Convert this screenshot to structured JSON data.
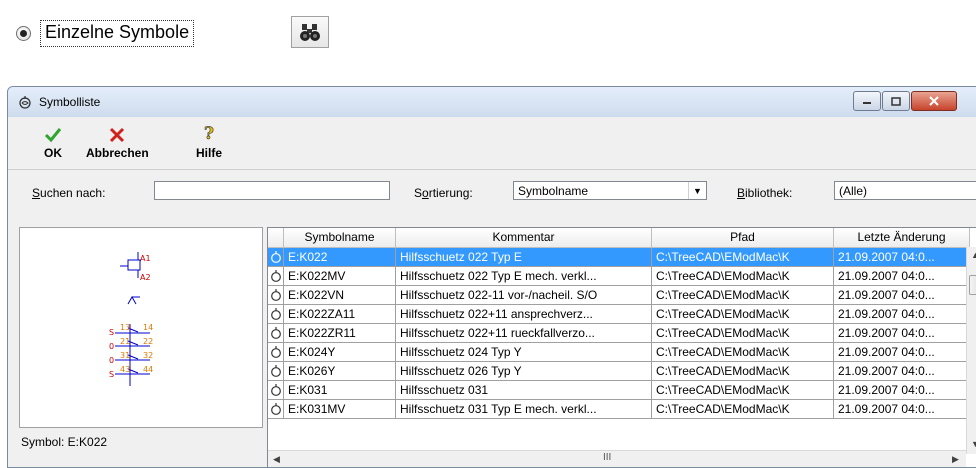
{
  "top": {
    "radio_label": "Einzelne Symbole",
    "radio_checked": true,
    "search_button_icon": "binoculars-icon"
  },
  "window": {
    "title": "Symbolliste",
    "title_icon": "coil-icon"
  },
  "toolbar": {
    "ok_label": "OK",
    "cancel_label": "Abbrechen",
    "help_label": "Hilfe"
  },
  "search": {
    "search_label_underlined": "S",
    "search_label_rest": "uchen nach:",
    "search_value": "",
    "sort_label_pre": "S",
    "sort_label_underlined": "o",
    "sort_label_rest": "rtierung:",
    "sort_value": "Symbolname",
    "library_label_underlined": "B",
    "library_label_rest": "ibliothek:",
    "library_value": "(Alle)"
  },
  "preview": {
    "caption": "Symbol: E:K022",
    "labels": {
      "a1": "A1",
      "a2": "A2",
      "n13": "13",
      "n14": "14",
      "n21": "21",
      "n22": "22",
      "n31": "31",
      "n32": "32",
      "n43": "43",
      "n44": "44",
      "s1": "S",
      "s2": "0",
      "s3": "0",
      "s4": "S"
    }
  },
  "table": {
    "columns": [
      "",
      "Symbolname",
      "Kommentar",
      "Pfad",
      "Letzte Änderung"
    ],
    "rows": [
      {
        "name": "E:K022",
        "comment": "Hilfsschuetz 022 Typ E",
        "path": "C:\\TreeCAD\\EModMac\\K",
        "date": "21.09.2007 04:0...",
        "selected": true
      },
      {
        "name": "E:K022MV",
        "comment": "Hilfsschuetz 022 Typ E mech. verkl...",
        "path": "C:\\TreeCAD\\EModMac\\K",
        "date": "21.09.2007 04:0..."
      },
      {
        "name": "E:K022VN",
        "comment": "Hilfsschuetz 022-11 vor-/nacheil. S/O",
        "path": "C:\\TreeCAD\\EModMac\\K",
        "date": "21.09.2007 04:0..."
      },
      {
        "name": "E:K022ZA11",
        "comment": "Hilfsschuetz 022+11 ansprechverz...",
        "path": "C:\\TreeCAD\\EModMac\\K",
        "date": "21.09.2007 04:0..."
      },
      {
        "name": "E:K022ZR11",
        "comment": "Hilfsschuetz 022+11 rueckfallverzo...",
        "path": "C:\\TreeCAD\\EModMac\\K",
        "date": "21.09.2007 04:0..."
      },
      {
        "name": "E:K024Y",
        "comment": "Hilfsschuetz 024 Typ Y",
        "path": "C:\\TreeCAD\\EModMac\\K",
        "date": "21.09.2007 04:0..."
      },
      {
        "name": "E:K026Y",
        "comment": "Hilfsschuetz 026 Typ Y",
        "path": "C:\\TreeCAD\\EModMac\\K",
        "date": "21.09.2007 04:0..."
      },
      {
        "name": "E:K031",
        "comment": "Hilfsschuetz 031",
        "path": "C:\\TreeCAD\\EModMac\\K",
        "date": "21.09.2007 04:0..."
      },
      {
        "name": "E:K031MV",
        "comment": "Hilfsschuetz 031 Typ E mech. verkl...",
        "path": "C:\\TreeCAD\\EModMac\\K",
        "date": "21.09.2007 04:0..."
      }
    ],
    "scroll_glyph": "III"
  },
  "colors": {
    "selection": "#3399ff",
    "ok_check": "#2fa52f",
    "cancel_x": "#d0201a",
    "symbol_red": "#cc0000",
    "symbol_blue": "#0000cc",
    "symbol_orange": "#e07800"
  }
}
